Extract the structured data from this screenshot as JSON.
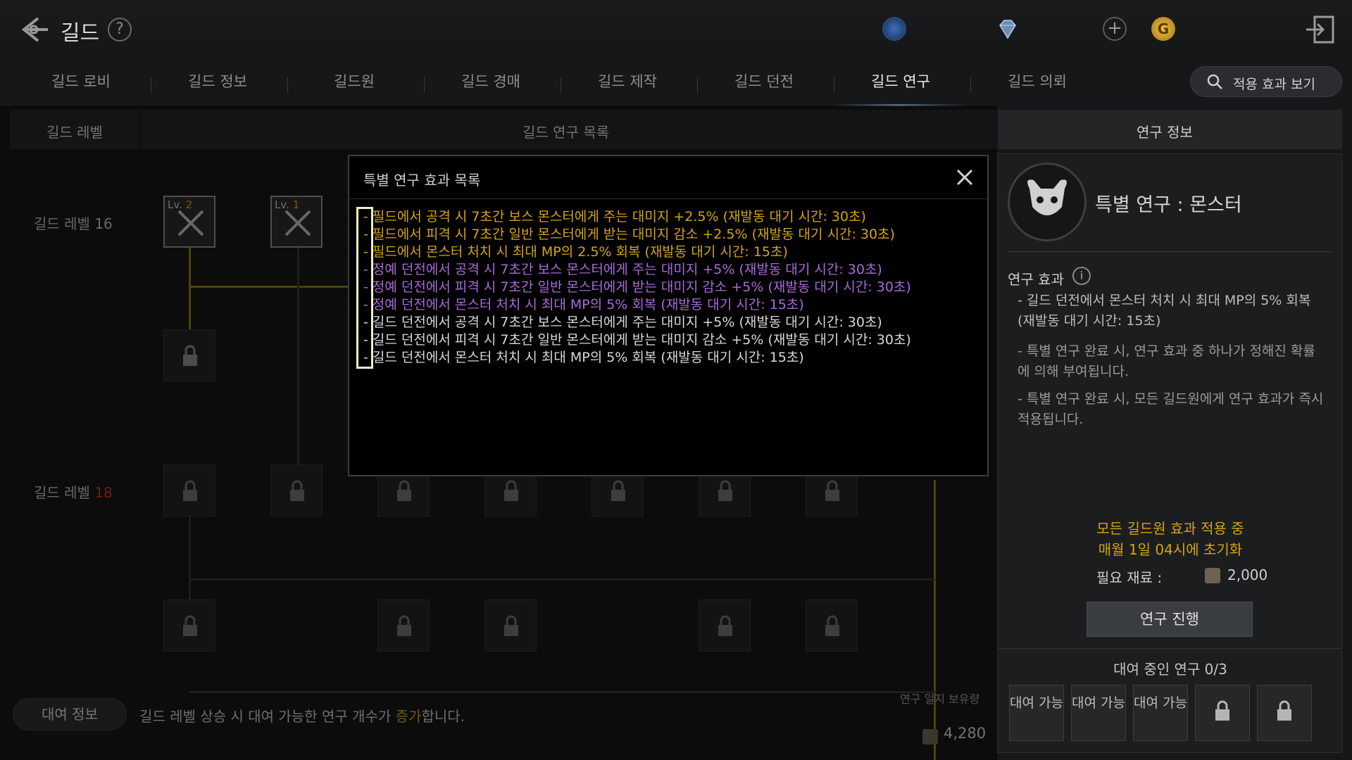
{
  "header": {
    "title": "길드",
    "help": "?",
    "plus": "+",
    "gold_symbol": "G"
  },
  "tabs": [
    {
      "label": "길드 로비"
    },
    {
      "label": "길드 정보"
    },
    {
      "label": "길드원"
    },
    {
      "label": "길드 경매"
    },
    {
      "label": "길드 제작"
    },
    {
      "label": "길드 던전"
    },
    {
      "label": "길드 연구"
    },
    {
      "label": "길드 의뢰"
    }
  ],
  "active_tab": "길드 연구",
  "search": {
    "label": "적용 효과 보기"
  },
  "columns": {
    "level": "길드 레벨",
    "list": "길드 연구 목록",
    "info": "연구 정보"
  },
  "tree": {
    "level16": "길드 레벨 16",
    "level18_prefix": "길드 레벨 ",
    "level18_num": "18",
    "node1_lv_prefix": "Lv.",
    "node1_lv": "2",
    "node2_lv_prefix": "Lv.",
    "node2_lv": "1"
  },
  "bottom": {
    "rental_button": "대여 정보",
    "note_prefix": "길드 레벨 상승 시 대여 가능한 연구 개수가 ",
    "note_highlight": "증가",
    "note_suffix": "합니다.",
    "stock_label": "연구 일지 보유량",
    "stock_value": "4,280"
  },
  "modal": {
    "title": "특별 연구 효과 목록",
    "effects": [
      {
        "text": "- 필드에서 공격 시 7초간 보스 몬스터에게 주는 대미지 +2.5% (재발동 대기 시간: 30초)",
        "tier": "gold"
      },
      {
        "text": "- 필드에서 피격 시 7초간 일반 몬스터에게 받는 대미지 감소 +2.5% (재발동 대기 시간: 30초)",
        "tier": "gold"
      },
      {
        "text": "- 필드에서 몬스터 처치 시 최대 MP의 2.5% 회복  (재발동 대기 시간: 15초)",
        "tier": "gold"
      },
      {
        "text": "- 정예 던전에서 공격 시 7초간 보스 몬스터에게 주는 대미지 +5% (재발동 대기 시간: 30초)",
        "tier": "purple"
      },
      {
        "text": "- 정예 던전에서 피격 시 7초간 일반 몬스터에게 받는 대미지 감소 +5% (재발동 대기 시간: 30초)",
        "tier": "purple"
      },
      {
        "text": "- 정예 던전에서 몬스터 처치 시 최대 MP의 5% 회복  (재발동 대기 시간: 15초)",
        "tier": "purple"
      },
      {
        "text": "- 길드 던전에서 공격 시 7초간 보스 몬스터에게 주는 대미지 +5% (재발동 대기 시간: 30초)",
        "tier": "white"
      },
      {
        "text": "- 길드 던전에서 피격 시 7초간 일반 몬스터에게 받는 대미지 감소 +5% (재발동 대기 시간: 30초)",
        "tier": "white"
      },
      {
        "text": "- 길드 던전에서 몬스터 처치 시 최대 MP의 5% 회복  (재발동 대기 시간: 15초)",
        "tier": "white"
      }
    ]
  },
  "research_info": {
    "title": "특별 연구 : 몬스터",
    "effect_label": "연구 효과",
    "info_symbol": "i",
    "effect_line1": "- 길드 던전에서 몬스터 처치 시 최대 MP의 5% 회복",
    "effect_line2": "(재발동 대기 시간: 15초)",
    "note1": "- 특별 연구 완료 시, 연구 효과 중 하나가 정해진 확률에 의해 부여됩니다.",
    "note2": "- 특별 연구 완료 시, 모든 길드원에게 연구 효과가 즉시 적용됩니다.",
    "status1": "모든 길드원 효과 적용 중",
    "status2": "매월 1일 04시에 초기화",
    "material_label": "필요 재료 :",
    "material_value": "2,000",
    "research_button": "연구 진행",
    "rental_title": "대여 중인 연구 0/3",
    "slot_label": "대여 가능"
  },
  "colors": {
    "accent_gold": "#d4a514",
    "accent_purple": "#a86ad8",
    "highlight_box": "#f3eec3"
  }
}
